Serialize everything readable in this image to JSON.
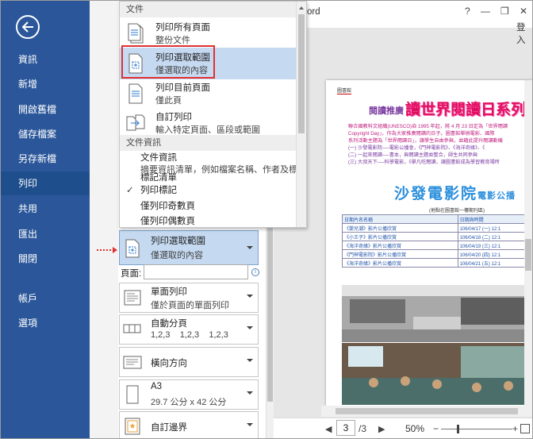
{
  "window": {
    "title_fragment": "ord",
    "help": "?",
    "minimize": "—",
    "restore": "❐",
    "close": "✕",
    "signin": "登入"
  },
  "nav": {
    "items": [
      {
        "label": "資訊"
      },
      {
        "label": "新增"
      },
      {
        "label": "開啟舊檔"
      },
      {
        "label": "儲存檔案"
      },
      {
        "label": "另存新檔"
      },
      {
        "label": "列印",
        "active": true
      },
      {
        "label": "共用"
      },
      {
        "label": "匯出"
      },
      {
        "label": "關閉"
      },
      {
        "label": "帳戶"
      },
      {
        "label": "選項"
      }
    ]
  },
  "dropdown": {
    "header_docs": "文件",
    "items": [
      {
        "title": "列印所有頁面",
        "desc": "整份文件"
      },
      {
        "title": "列印選取範圍",
        "desc": "僅選取的內容"
      },
      {
        "title": "列印目前頁面",
        "desc": "僅此頁"
      },
      {
        "title": "自訂列印",
        "desc": "輸入特定頁面、區段或範圍"
      }
    ],
    "header_info": "文件資訊",
    "info_item": {
      "title": "文件資訊",
      "desc": "摘要資訊清單，例如檔案名稱、作者及標題"
    },
    "info_cut": "標記清單",
    "checked": "列印標記",
    "odd": "僅列印奇數頁",
    "even": "僅列印偶數頁"
  },
  "settings": {
    "range": {
      "title": "列印選取範圍",
      "desc": "僅選取的內容"
    },
    "pages_label": "頁面:",
    "sides": {
      "title": "單面列印",
      "desc": "僅於頁面的單面列印"
    },
    "collate": {
      "title": "自動分頁",
      "desc": "1,2,3    1,2,3    1,2,3"
    },
    "orientation": {
      "title": "橫向方向"
    },
    "paper": {
      "title": "A3",
      "desc": "29.7 公分 x 42 公分"
    },
    "margins": {
      "title": "自訂邊界"
    }
  },
  "document": {
    "tag": "圖書館",
    "heading_small": "閱讀推廣",
    "heading_big": "讀世界閱讀日系列",
    "paragraphs": [
      "聯合國教科文組織(UNESCO)自 1995 年起，將 4 月 23 日定為「世界閱讀",
      "Copyright Day」，作為大家推廣閱讀的日子。圖書館舉辦電影、國際",
      "系列活動主題為「世界閱讀日」，讓學生自由參與，並藉此提升閱讀動機",
      "(一) 沙發電影院──電影公播會，《門神電影院》、《海洋奇緣》、《",
      "(二) 一起來閱讀──書本，與閱讀主題並整合，師生共同參與",
      "(三) 大叔天下──科學電影，《舉凡吃閱讀，讓圖書館成為學習教育場所"
    ],
    "cinema_title": "沙發電影院",
    "cinema_small": "電影公播",
    "cinema_sub": "(地點在圖書館一樓期刊區)",
    "table": {
      "headers": [
        "日期片名名稱",
        "日期與時間"
      ],
      "rows": [
        [
          "《嬰兒潮》影片公播欣賞",
          "106/04/17 (一) 12:1"
        ],
        [
          "《小王子》影片公播欣賞",
          "106/04/18 (二) 12:1"
        ],
        [
          "《海洋奇緣》影片公播欣賞",
          "106/04/19 (三) 12:1"
        ],
        [
          "《門神電影院》影片公播欣賞",
          "106/04/20 (四) 12:1"
        ],
        [
          "《海洋奇緣》影片公播欣賞",
          "106/04/21 (五) 12:1"
        ]
      ]
    }
  },
  "statusbar": {
    "prev": "◀",
    "page": "3",
    "total": "/3",
    "next": "▶",
    "zoom": "50%",
    "minus": "−",
    "plus": "+"
  },
  "colors": {
    "nav_bg": "#2b579a",
    "nav_active": "#1e4e8c",
    "highlight": "#c5d9f1",
    "red_outline": "#e03030"
  }
}
